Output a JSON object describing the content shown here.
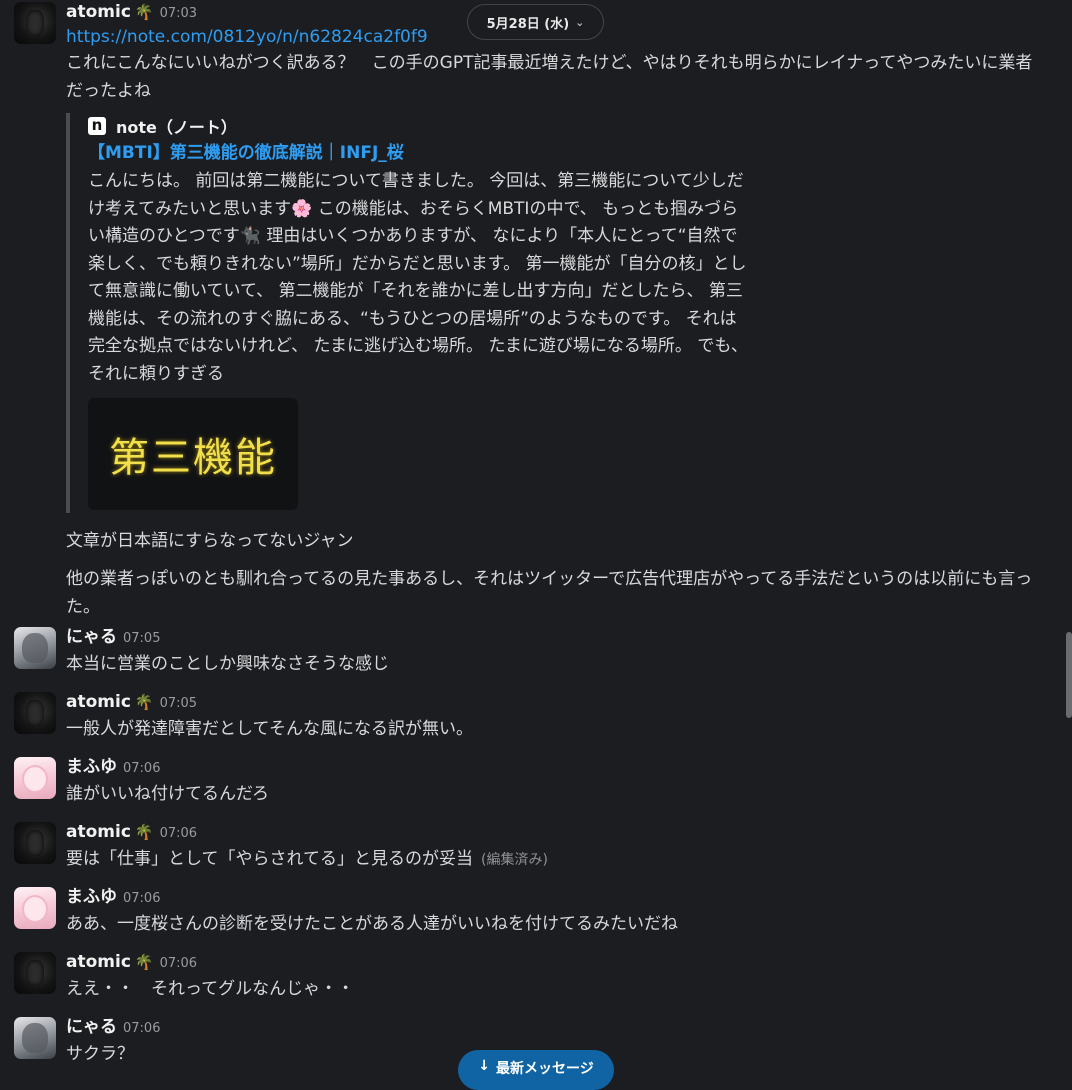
{
  "date_divider": {
    "label": "5月28日 (水)"
  },
  "new_messages_button": {
    "label": "最新メッセージ"
  },
  "messages": [
    {
      "author": "atomic",
      "badge": "🌴",
      "time": "07:03",
      "link": "https://note.com/0812yo/n/n62824ca2f0f9",
      "text": "これにこんなにいいねがつく訳ある？　この手のGPT記事最近増えたけど、やはりそれも明らかにレイナってやつみたいに業者だったよね",
      "unfurl": {
        "source": "note（ノート）",
        "title": "【MBTI】第三機能の徹底解説｜INFJ_桜",
        "description": "こんにちは。 前回は第二機能について書きました。 今回は、第三機能について少しだけ考えてみたいと思います🌸 この機能は、おそらくMBTIの中で、 もっとも掴みづらい構造のひとつです🐈‍⬛ 理由はいくつかありますが、 なにより「本人にとって“自然で楽しく、でも頼りきれない”場所」だからだと思います。 第一機能が「自分の核」として無意識に働いていて、 第二機能が「それを誰かに差し出す方向」だとしたら、 第三機能は、その流れのすぐ脇にある、“もうひとつの居場所”のようなものです。 それは完全な拠点ではないけれど、 たまに逃げ込む場所。 たまに遊び場になる場所。 でも、それに頼りすぎる",
        "image_text": "第三機能"
      },
      "followups": [
        "文章が日本語にすらなってないジャン",
        "他の業者っぽいのとも馴れ合ってるの見た事あるし、それはツイッターで広告代理店がやってる手法だというのは以前にも言った。"
      ]
    },
    {
      "author": "にゃる",
      "time": "07:05",
      "text": "本当に営業のことしか興味なさそうな感じ"
    },
    {
      "author": "atomic",
      "badge": "🌴",
      "time": "07:05",
      "text": "一般人が発達障害だとしてそんな風になる訳が無い。"
    },
    {
      "author": "まふゆ",
      "time": "07:06",
      "text": "誰がいいね付けてるんだろ"
    },
    {
      "author": "atomic",
      "badge": "🌴",
      "time": "07:06",
      "text": "要は「仕事」として「やらされてる」と見るのが妥当",
      "edited": "(編集済み)"
    },
    {
      "author": "まふゆ",
      "time": "07:06",
      "text": "ああ、一度桜さんの診断を受けたことがある人達がいいねを付けてるみたいだね"
    },
    {
      "author": "atomic",
      "badge": "🌴",
      "time": "07:06",
      "text": "ええ・・　それってグルなんじゃ・・"
    },
    {
      "author": "にゃる",
      "time": "07:06",
      "text": "サクラ？"
    }
  ]
}
